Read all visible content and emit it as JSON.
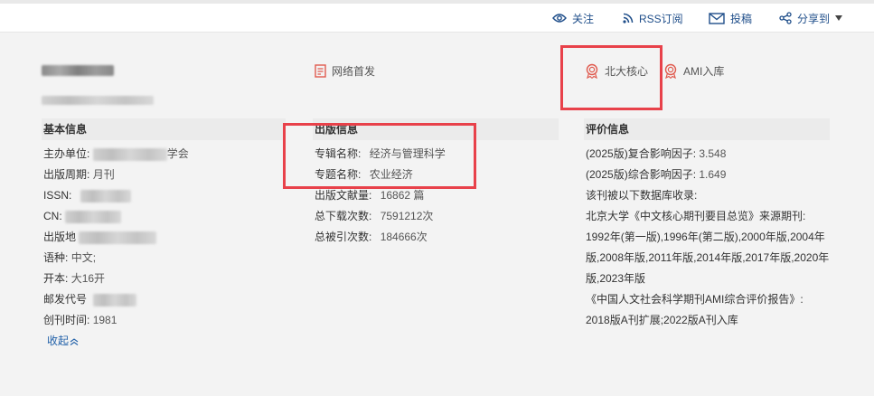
{
  "toolbar": {
    "follow": "关注",
    "rss": "RSS订阅",
    "submit": "投稿",
    "share": "分享到"
  },
  "tags": {
    "online_first": "网络首发",
    "pku_core": "北大核心",
    "ami": "AMI入库"
  },
  "basic": {
    "heading": "基本信息",
    "sponsor_label": "主办单位:",
    "sponsor_visible_suffix": "学会",
    "period_label": "出版周期:",
    "period_value": "月刊",
    "issn_label": "ISSN:",
    "cn_label": "CN:",
    "place_label": "出版地",
    "language_label": "语种:",
    "language_value": "中文;",
    "format_label": "开本:",
    "format_value": "大16开",
    "postal_label": "邮发代号",
    "founded_label": "创刊时间:",
    "founded_value": "1981",
    "collapse": "收起"
  },
  "publish": {
    "heading": "出版信息",
    "album_label": "专辑名称:",
    "album_value": "经济与管理科学",
    "topic_label": "专题名称:",
    "topic_value": "农业经济",
    "articles_label": "出版文献量:",
    "articles_value": "16862 篇",
    "downloads_label": "总下载次数:",
    "downloads_value": "7591212次",
    "citations_label": "总被引次数:",
    "citations_value": "184666次"
  },
  "evaluation": {
    "heading": "评价信息",
    "composite_label": "(2025版)复合影响因子:",
    "composite_value": "3.548",
    "comprehensive_label": "(2025版)综合影响因子:",
    "comprehensive_value": "1.649",
    "db_intro": "该刊被以下数据库收录:",
    "pku_line": "北京大学《中文核心期刊要目总览》来源期刊:",
    "pku_years_1": "1992年(第一版),1996年(第二版),2000年版,2004年",
    "pku_years_2": "版,2008年版,2011年版,2014年版,2017年版,2020年",
    "pku_years_3": "版,2023年版",
    "ami_line": "《中国人文社会科学期刊AMI综合评价报告》:",
    "ami_years": "2018版A刊扩展;2022版A刊入库"
  },
  "colors": {
    "link": "#1f4e8a",
    "highlight_box": "#e8414a",
    "badge": "#e05a4e"
  }
}
